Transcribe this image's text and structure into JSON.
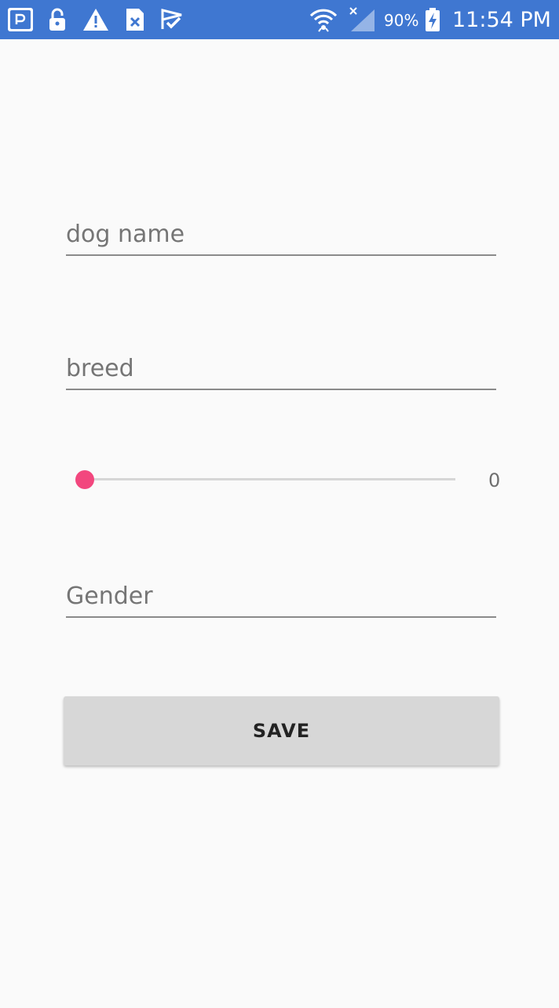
{
  "status_bar": {
    "left_icons": [
      "parking-app-icon",
      "lock-icon",
      "warning-icon",
      "close-box-icon",
      "check-flag-icon"
    ],
    "right_icons": [
      "wifi-icon",
      "no-signal-icon",
      "battery-charging-icon"
    ],
    "battery": "90%",
    "time": "11:54 PM"
  },
  "form": {
    "dog_name": {
      "placeholder": "dog name",
      "value": ""
    },
    "breed": {
      "placeholder": "breed",
      "value": ""
    },
    "age_slider": {
      "value": 0,
      "value_label": "0",
      "accent_color": "#f2477e"
    },
    "gender": {
      "placeholder": "Gender",
      "value": ""
    },
    "save_label": "SAVE"
  },
  "colors": {
    "status_bar": "#3f77d1",
    "background": "#fafafa",
    "button": "#d7d7d7"
  }
}
